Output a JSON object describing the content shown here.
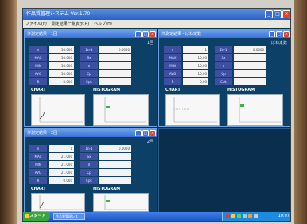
{
  "app": {
    "title": "作品質管理システム Ver.1.70",
    "menu": [
      "ファイル(F)",
      "測定結果一覧表示(R)",
      "ヘルプ(H)"
    ]
  },
  "windows": [
    {
      "title": "作測定結果 - 1回",
      "caption": "1回",
      "left_labels": [
        "n",
        "MAX",
        "MIN",
        "AVG",
        "R"
      ],
      "left_values": [
        "10.000",
        "10.000",
        "10.000",
        "10.000",
        "0.000"
      ],
      "right_labels": [
        "Σn-1",
        "Sx",
        "σ",
        "Cp",
        "Cpk"
      ],
      "right_values": [
        "0.0000",
        "",
        "",
        "",
        ""
      ],
      "chart_label": "CHART",
      "hist_label": "HISTOGRAM"
    },
    {
      "title": "作測定結果 - ばね定数",
      "caption": "ばね定数",
      "left_labels": [
        "n",
        "MAX",
        "MIN",
        "AVG",
        "R"
      ],
      "left_values": [
        "1",
        "10.00",
        "10.00",
        "10.00",
        "0.00"
      ],
      "right_labels": [
        "Σn-1",
        "Sx",
        "σ",
        "Cp",
        "Cpk"
      ],
      "right_values": [
        "0.0000",
        "",
        "",
        "",
        ""
      ],
      "chart_label": "CHART",
      "hist_label": "HISTOGRAM"
    },
    {
      "title": "作測定結果 - 2回",
      "caption": "2回",
      "left_labels": [
        "n",
        "MAX",
        "MIN",
        "AVG",
        "R"
      ],
      "left_values": [
        "1",
        "21.000",
        "21.000",
        "21.000",
        "0.000"
      ],
      "right_labels": [
        "Σn-1",
        "Sx",
        "σ",
        "Cp",
        "Cpk"
      ],
      "right_values": [
        "0.0000",
        "",
        "",
        "",
        ""
      ],
      "chart_label": "CHART",
      "hist_label": "HISTOGRAM"
    }
  ],
  "taskbar": {
    "start_label": "スタート",
    "task_item": "作品質管理シス",
    "clock": "10:07"
  }
}
